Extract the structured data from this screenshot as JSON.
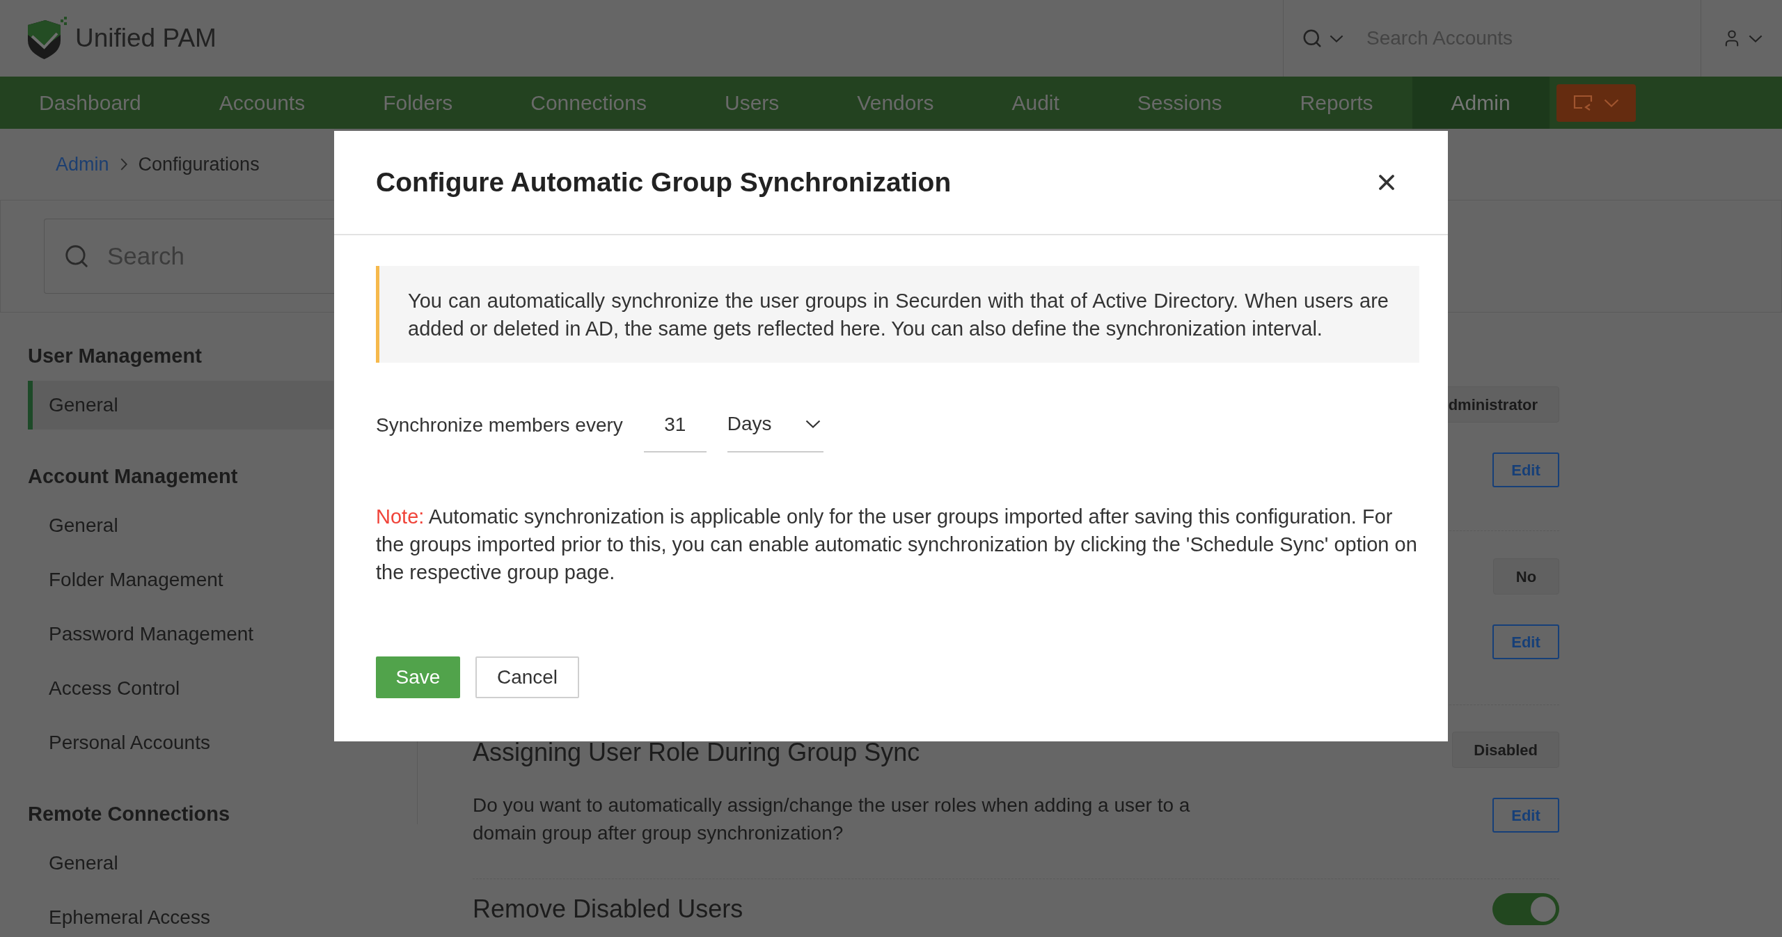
{
  "header": {
    "logo_text": "Unified PAM",
    "search": {
      "placeholder": "Search Accounts"
    }
  },
  "nav": {
    "items": [
      {
        "label": "Dashboard",
        "selected": false
      },
      {
        "label": "Accounts",
        "selected": false
      },
      {
        "label": "Folders",
        "selected": false
      },
      {
        "label": "Connections",
        "selected": false
      },
      {
        "label": "Users",
        "selected": false
      },
      {
        "label": "Vendors",
        "selected": false
      },
      {
        "label": "Audit",
        "selected": false
      },
      {
        "label": "Sessions",
        "selected": false
      },
      {
        "label": "Reports",
        "selected": false
      },
      {
        "label": "Admin",
        "selected": true
      }
    ]
  },
  "breadcrumb": [
    {
      "label": "Admin",
      "kind": "link"
    },
    {
      "label": "Configurations",
      "kind": "current"
    }
  ],
  "config_search": {
    "placeholder": "Search"
  },
  "sidebar": {
    "sections": [
      {
        "title": "User Management",
        "items": [
          {
            "label": "General",
            "selected": true
          }
        ]
      },
      {
        "title": "Account Management",
        "items": [
          {
            "label": "General",
            "selected": false
          },
          {
            "label": "Folder Management",
            "selected": false
          },
          {
            "label": "Password Management",
            "selected": false
          },
          {
            "label": "Access Control",
            "selected": false
          },
          {
            "label": "Personal Accounts",
            "selected": false
          }
        ]
      },
      {
        "title": "Remote Connections",
        "items": [
          {
            "label": "General",
            "selected": false
          },
          {
            "label": "Ephemeral Access",
            "selected": false
          }
        ]
      }
    ]
  },
  "settings": [
    {
      "kind": "value",
      "value": "dministrator",
      "button": "Edit"
    },
    {
      "kind": "value",
      "value": "No",
      "button": "Edit"
    },
    {
      "kind": "value",
      "title": "Assigning User Role During Group Sync",
      "description": "Do you want to automatically assign/change the user roles when adding a user to a domain group after group synchronization?",
      "value": "Disabled",
      "button": "Edit"
    },
    {
      "kind": "toggle",
      "title": "Remove Disabled Users",
      "on": true
    }
  ],
  "dialog": {
    "title": "Configure Automatic Group Synchronization",
    "info": "You can automatically synchronize the user groups in Securden with that of Active Directory. When users are added or deleted in AD, the same gets reflected here. You can also define the synchronization interval.",
    "interval": {
      "label": "Synchronize members every",
      "value": "31",
      "unit": "Days"
    },
    "note_label": "Note:",
    "note": "Automatic synchronization is applicable only for the user groups imported after saving this configuration. For the groups imported prior to this, you can enable automatic synchronization by clicking the 'Schedule Sync' option on the respective group page.",
    "buttons": [
      {
        "label": "Save",
        "kind": "primary"
      },
      {
        "label": "Cancel",
        "kind": "secondary"
      }
    ]
  }
}
